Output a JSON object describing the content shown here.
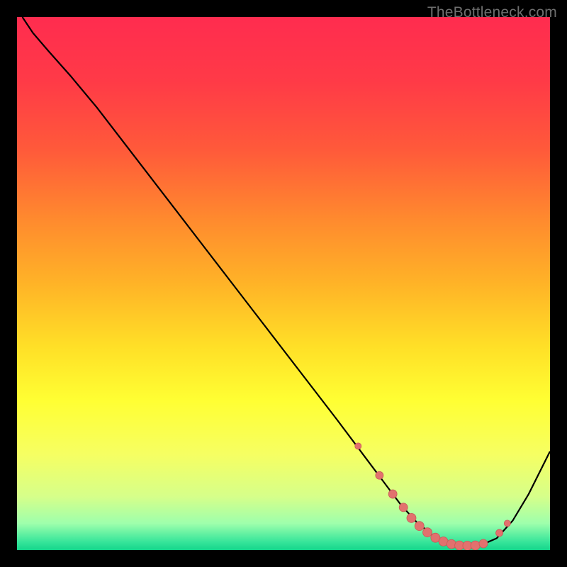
{
  "watermark": "TheBottleneck.com",
  "colors": {
    "bg": "#000000",
    "gradient_stops": [
      {
        "offset": 0.0,
        "color": "#ff2c4f"
      },
      {
        "offset": 0.12,
        "color": "#ff3a47"
      },
      {
        "offset": 0.25,
        "color": "#ff5a3a"
      },
      {
        "offset": 0.38,
        "color": "#ff8a2e"
      },
      {
        "offset": 0.5,
        "color": "#ffb327"
      },
      {
        "offset": 0.62,
        "color": "#ffe027"
      },
      {
        "offset": 0.72,
        "color": "#ffff33"
      },
      {
        "offset": 0.82,
        "color": "#f6ff62"
      },
      {
        "offset": 0.9,
        "color": "#d6ff8a"
      },
      {
        "offset": 0.95,
        "color": "#9effac"
      },
      {
        "offset": 0.985,
        "color": "#36e59a"
      },
      {
        "offset": 1.0,
        "color": "#14d68b"
      }
    ],
    "curve": "#000000",
    "marker_fill": "#e2716e",
    "marker_stroke": "#c95a57"
  },
  "chart_data": {
    "type": "line",
    "title": "",
    "xlabel": "",
    "ylabel": "",
    "xlim": [
      0,
      100
    ],
    "ylim": [
      0,
      100
    ],
    "grid": false,
    "legend": "none",
    "series": [
      {
        "name": "bottleneck-curve",
        "x": [
          1,
          3,
          6,
          10,
          15,
          20,
          25,
          30,
          35,
          40,
          45,
          50,
          55,
          60,
          63,
          66,
          69,
          72,
          75,
          78,
          81,
          84,
          87,
          90,
          93,
          96,
          100
        ],
        "y": [
          100,
          97,
          93.5,
          89,
          83,
          76.5,
          70,
          63.5,
          57,
          50.5,
          44,
          37.5,
          31,
          24.5,
          20.5,
          16.5,
          12.5,
          8.5,
          5.2,
          2.8,
          1.4,
          0.8,
          0.9,
          2.2,
          5.5,
          10.5,
          18.5
        ]
      }
    ],
    "markers": {
      "name": "highlighted-points",
      "x": [
        64,
        68,
        70.5,
        72.5,
        74,
        75.5,
        77,
        78.5,
        80,
        81.5,
        83,
        84.5,
        86,
        87.5,
        90.5,
        92
      ],
      "y": [
        19.5,
        14,
        10.5,
        8,
        6,
        4.5,
        3.3,
        2.3,
        1.6,
        1.1,
        0.85,
        0.8,
        0.85,
        1.2,
        3.2,
        5.0
      ],
      "r": [
        4.5,
        5.5,
        6,
        6,
        6.5,
        6.5,
        6.5,
        6.5,
        6.5,
        6.5,
        6.5,
        6.5,
        6.5,
        6,
        5,
        4.5
      ]
    }
  }
}
